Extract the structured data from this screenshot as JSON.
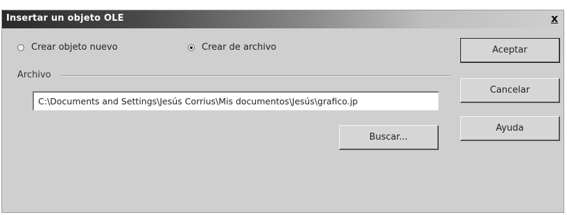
{
  "window": {
    "title": "Insertar un objeto OLE",
    "close_label": "x"
  },
  "options": {
    "create_new": {
      "label": "Crear objeto nuevo",
      "checked": false
    },
    "create_from_file": {
      "label": "Crear de archivo",
      "checked": true
    }
  },
  "file_group": {
    "label": "Archivo",
    "path_value": "C:\\Documents and Settings\\Jesús Corrius\\Mis documentos\\Jesús\\grafico.jp",
    "browse_label": "Buscar..."
  },
  "buttons": {
    "accept": "Aceptar",
    "cancel": "Cancelar",
    "help": "Ayuda"
  }
}
